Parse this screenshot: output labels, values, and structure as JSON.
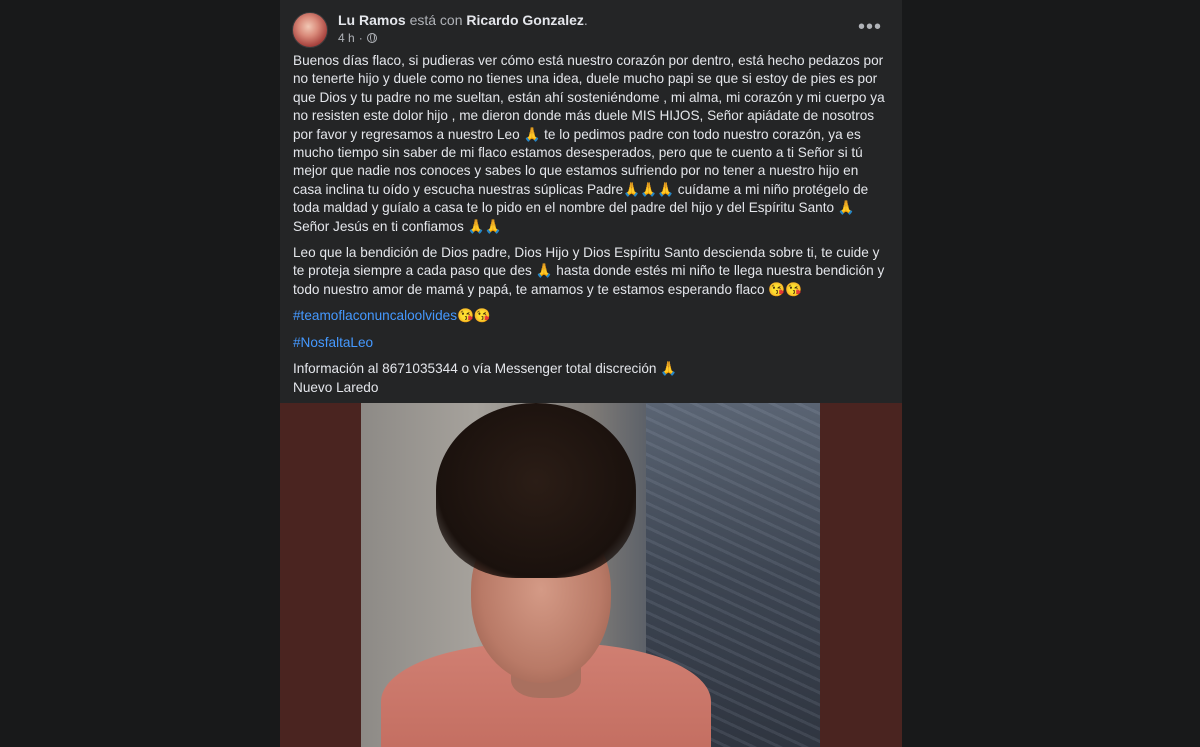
{
  "post": {
    "author": "Lu Ramos",
    "with_text": "está con",
    "tagged": "Ricardo Gonzalez",
    "tagged_suffix": ".",
    "time": "4 h",
    "time_sep": "·",
    "privacy_icon": "globe-icon",
    "more_icon": "more-options-icon",
    "more_label": "•••",
    "paragraphs": [
      "Buenos días flaco, si pudieras ver cómo está nuestro corazón por dentro, está hecho pedazos por no tenerte hijo y duele como no tienes una idea, duele mucho papi se que si estoy de pies es por que Dios y tu padre no me sueltan, están ahí sosteniéndome , mi alma, mi corazón y mi cuerpo ya no resisten este dolor hijo , me dieron donde más duele MIS HIJOS, Señor apiádate de  nosotros por favor y regresamos a  nuestro Leo 🙏 te lo pedimos padre con todo nuestro corazón, ya es mucho tiempo sin saber de mi flaco estamos desesperados, pero que te cuento a ti Señor si tú mejor que nadie nos conoces y sabes lo que estamos sufriendo por no tener a nuestro hijo en casa inclina tu oído y escucha nuestras súplicas Padre🙏🙏🙏 cuídame a mi niño protégelo de toda maldad y guíalo a casa te lo pido en el nombre del padre del hijo y del Espíritu Santo 🙏 Señor Jesús en ti confiamos 🙏🙏",
      "Leo que la bendición de Dios padre, Dios Hijo y Dios Espíritu Santo descienda sobre ti, te cuide y te proteja siempre  a cada paso que des 🙏 hasta donde estés mi niño te llega nuestra bendición y todo nuestro amor de mamá y papá, te amamos  y te estamos esperando flaco 😘😘"
    ],
    "hashtag1": "#teamoflaconuncaloolvides",
    "hashtag1_emoji": "😘😘",
    "hashtag2": "#NosfaltaLeo",
    "info_line": "Información al 8671035344 o vía Messenger total discreción 🙏",
    "location_line": "Nuevo Laredo"
  },
  "colors": {
    "page_bg": "#18191a",
    "card_bg": "#242526",
    "text_primary": "#e4e6eb",
    "text_secondary": "#b0b3b8",
    "link": "#4599ff",
    "photo_frame": "#4a2420"
  }
}
